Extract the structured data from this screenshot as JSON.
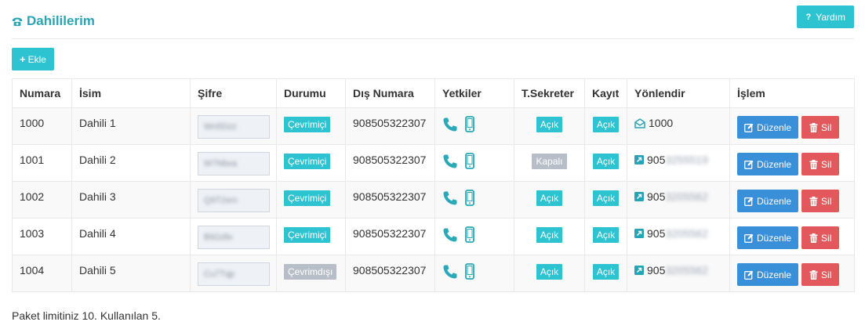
{
  "header": {
    "title": "Dahililerim",
    "help_label": "Yardım",
    "help_glyph": "?"
  },
  "toolbar": {
    "add_label": "Ekle",
    "add_glyph": "+"
  },
  "table": {
    "columns": [
      "Numara",
      "İsim",
      "Şifre",
      "Durumu",
      "Dış Numara",
      "Yetkiler",
      "T.Sekreter",
      "Kayıt",
      "Yönlendir",
      "İşlem"
    ],
    "rows": [
      {
        "number": "1000",
        "name": "Dahili 1",
        "password": "Wn5Dzz",
        "status": "Çevrimiçi",
        "status_online": true,
        "external": "908505322307",
        "secretary": "Açık",
        "secretary_on": true,
        "record": "Açık",
        "redirect_type": "internal",
        "redirect_prefix": "1000",
        "redirect_hidden": ""
      },
      {
        "number": "1001",
        "name": "Dahili 2",
        "password": "W7Nbxa",
        "status": "Çevrimiçi",
        "status_online": true,
        "external": "908505322307",
        "secretary": "Kapalı",
        "secretary_on": false,
        "record": "Açık",
        "redirect_type": "external",
        "redirect_prefix": "905",
        "redirect_hidden": "3255519"
      },
      {
        "number": "1002",
        "name": "Dahili 3",
        "password": "Q9T2srn",
        "status": "Çevrimiçi",
        "status_online": true,
        "external": "908505322307",
        "secretary": "Açık",
        "secretary_on": true,
        "record": "Açık",
        "redirect_type": "external",
        "redirect_prefix": "905",
        "redirect_hidden": "3205562"
      },
      {
        "number": "1003",
        "name": "Dahili 4",
        "password": "B92z8v",
        "status": "Çevrimiçi",
        "status_online": true,
        "external": "908505322307",
        "secretary": "Açık",
        "secretary_on": true,
        "record": "Açık",
        "redirect_type": "external",
        "redirect_prefix": "905",
        "redirect_hidden": "3205562"
      },
      {
        "number": "1004",
        "name": "Dahili 5",
        "password": "Cu7Tqp",
        "status": "Çevrimdışı",
        "status_online": false,
        "external": "908505322307",
        "secretary": "Açık",
        "secretary_on": true,
        "record": "Açık",
        "redirect_type": "external",
        "redirect_prefix": "905",
        "redirect_hidden": "3205562"
      }
    ],
    "edit_label": "Düzenle",
    "delete_label": "Sil"
  },
  "footer": {
    "limit_text": "Paket limitiniz 10. Kullanılan 5."
  },
  "colors": {
    "accent": "#2ec3d0",
    "title": "#2aa4b4",
    "phone_icon": "#2aa9b8",
    "edit": "#3a8fd9",
    "delete": "#e2585d",
    "offline": "#b8bec8"
  },
  "icons": {
    "title": "phone-icon",
    "help": "question-icon",
    "add": "plus-icon",
    "permissions": [
      "phone-icon",
      "mobile-icon"
    ],
    "redirect_internal": "envelope-open-icon",
    "redirect_external": "external-link-icon",
    "edit": "edit-icon",
    "delete": "trash-icon"
  }
}
